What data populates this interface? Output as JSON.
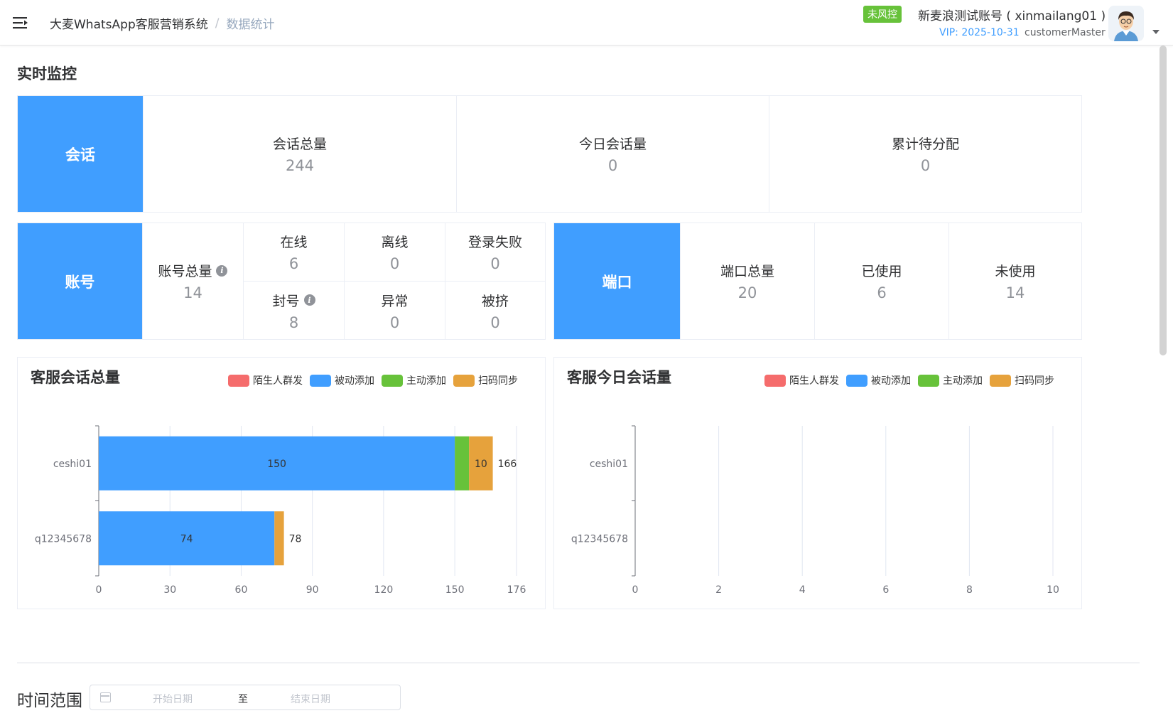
{
  "header": {
    "breadcrumb_root": "大麦WhatsApp客服营销系统",
    "breadcrumb_sep": "/",
    "breadcrumb_current": "数据统计",
    "risk_badge": "未风控",
    "account_name": "新麦浪测试账号 ( xinmailang01 )",
    "vip": "VIP: 2025-10-31",
    "role": "customerMaster"
  },
  "section_title": "实时监控",
  "session": {
    "label": "会话",
    "items": [
      {
        "label": "会话总量",
        "value": "244"
      },
      {
        "label": "今日会话量",
        "value": "0"
      },
      {
        "label": "累计待分配",
        "value": "0"
      }
    ]
  },
  "account": {
    "label": "账号",
    "total_label": "账号总量",
    "total_value": "14",
    "grid": [
      {
        "label": "在线",
        "value": "6"
      },
      {
        "label": "离线",
        "value": "0"
      },
      {
        "label": "登录失败",
        "value": "0"
      },
      {
        "label": "封号",
        "value": "8"
      },
      {
        "label": "异常",
        "value": "0"
      },
      {
        "label": "被挤",
        "value": "0"
      }
    ]
  },
  "port": {
    "label": "端口",
    "items": [
      {
        "label": "端口总量",
        "value": "20"
      },
      {
        "label": "已使用",
        "value": "6"
      },
      {
        "label": "未使用",
        "value": "14"
      }
    ]
  },
  "legend": [
    {
      "name": "陌生人群发",
      "color": "#f56c6c"
    },
    {
      "name": "被动添加",
      "color": "#409eff"
    },
    {
      "name": "主动添加",
      "color": "#67c23a"
    },
    {
      "name": "扫码同步",
      "color": "#e6a23c"
    }
  ],
  "chart_data": [
    {
      "type": "bar",
      "orientation": "horizontal",
      "stacked": true,
      "title": "客服会话总量",
      "categories": [
        "ceshi01",
        "q12345678"
      ],
      "series": [
        {
          "name": "陌生人群发",
          "values": [
            0,
            0
          ],
          "color": "#f56c6c"
        },
        {
          "name": "被动添加",
          "values": [
            150,
            74
          ],
          "color": "#409eff"
        },
        {
          "name": "主动添加",
          "values": [
            6,
            0
          ],
          "color": "#67c23a"
        },
        {
          "name": "扫码同步",
          "values": [
            10,
            4
          ],
          "color": "#e6a23c"
        }
      ],
      "totals": [
        166,
        78
      ],
      "xticks": [
        0,
        30,
        60,
        90,
        120,
        150,
        176
      ],
      "xlim": [
        0,
        176
      ]
    },
    {
      "type": "bar",
      "orientation": "horizontal",
      "stacked": true,
      "title": "客服今日会话量",
      "categories": [
        "ceshi01",
        "q12345678"
      ],
      "series": [
        {
          "name": "陌生人群发",
          "values": [
            0,
            0
          ],
          "color": "#f56c6c"
        },
        {
          "name": "被动添加",
          "values": [
            0,
            0
          ],
          "color": "#409eff"
        },
        {
          "name": "主动添加",
          "values": [
            0,
            0
          ],
          "color": "#67c23a"
        },
        {
          "name": "扫码同步",
          "values": [
            0,
            0
          ],
          "color": "#e6a23c"
        }
      ],
      "xticks": [
        0,
        2,
        4,
        6,
        8,
        10
      ],
      "xlim": [
        0,
        10
      ]
    }
  ],
  "filter": {
    "label": "时间范围",
    "start_placeholder": "开始日期",
    "separator": "至",
    "end_placeholder": "结束日期"
  }
}
